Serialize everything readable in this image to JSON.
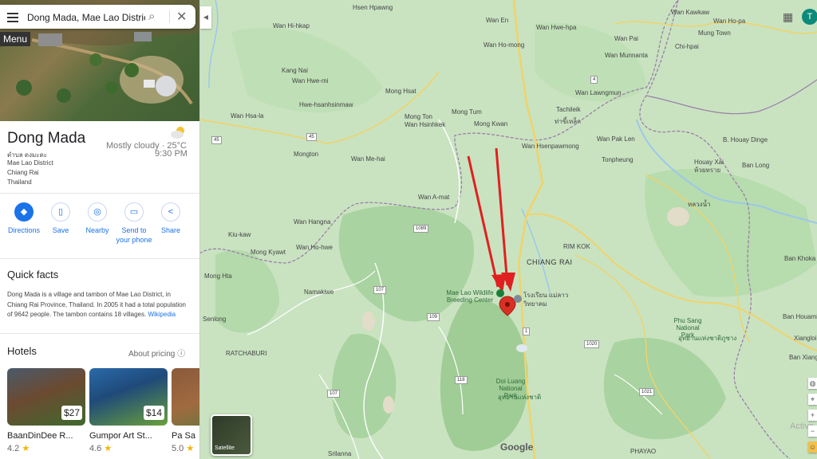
{
  "search": {
    "value": "Dong Mada, Mae Lao District, Chiang Rai",
    "menu_label": "Menu"
  },
  "place": {
    "name": "Dong Mada",
    "name_thai": "ตำบล ดงมะดะ",
    "address": [
      "Mae Lao District",
      "Chiang Rai",
      "Thailand"
    ],
    "weather": "Mostly cloudy · 25°C",
    "time": "9:30 PM"
  },
  "actions": [
    "Directions",
    "Save",
    "Nearby",
    "Send to your phone",
    "Share"
  ],
  "quick_facts": {
    "heading": "Quick facts",
    "text": "Dong Mada is a village and tambon of Mae Lao District, in Chiang Rai Province, Thailand. In 2005 it had a total population of 9642 people. The tambon contains 18 villages.",
    "link": "Wikipedia"
  },
  "hotels": {
    "heading": "Hotels",
    "about_pricing": "About pricing",
    "items": [
      {
        "name": "BaanDinDee R...",
        "rating": "4.2",
        "price": "$27"
      },
      {
        "name": "Gumpor Art St...",
        "rating": "4.6",
        "price": "$14"
      },
      {
        "name": "Pa Sa",
        "rating": "5.0",
        "price": ""
      }
    ]
  },
  "map": {
    "satellite_label": "Satellite",
    "attribution": "Google",
    "activate_text": "Activa",
    "avatar_letter": "T",
    "labels": [
      "Hsen Hpawng",
      "Wan Hi-hkap",
      "Wan En",
      "Wan Hsa",
      "Wan Kawkaw",
      "Wan Hwe-hpa",
      "Wan Ho-mong",
      "Wan Pai",
      "Wan Ho-pa",
      "Mung Town",
      "Chi-hpai",
      "Wan Munnanta",
      "Kang Nai",
      "Wan Hwe-mi",
      "Wan Lawngmun",
      "Mong Hsat",
      "Hwe-hsanhsinmaw",
      "Tachileik",
      "Wan Hsa-la",
      "Mong Ton",
      "Mong Tum",
      "Wan Hsinhkek",
      "Mong Kwan",
      "Wan Hsenpawmong",
      "Mongton",
      "Wan Pak Len",
      "Tonpheung",
      "B. Houay Dinge",
      "Houay Xai",
      "Wan Me-hai",
      "Ban Long",
      "Wan A-mat",
      "Wan Hangna",
      "Kiu-kaw",
      "Wan Ho-hwe",
      "Mong Kyawt",
      "Mong Hta",
      "Namakiwe",
      "RIM KOK",
      "CHIANG RAI",
      "Mae Lao Wildlife Breeding Center",
      "Ban Khoka",
      "Phu Sang National Park",
      "Ban Houamiang",
      "Xiangloi",
      "Ban Xiangh",
      "Doi Luang National Park",
      "RATCHABURI",
      "Srilanna",
      "PHAYAO",
      "Senlong"
    ],
    "thai_labels": [
      "เขตแฮนด์",
      "ท่าขี้เหล็ก",
      "ห้วยทราย",
      "หลวงน้ำ",
      "โรงเรียน แม่ลาว",
      "วิทยาคม",
      "อุทยานแห่งชาติ",
      "ดอยหลวง",
      "อุทยานแห่งชาติภูซาง"
    ],
    "route_shields": [
      "45",
      "45",
      "4",
      "1089",
      "107",
      "1098",
      "118",
      "1",
      "1020",
      "107",
      "1021",
      "118",
      "109"
    ]
  },
  "colors": {
    "accent": "#1a73e8",
    "arrow": "#e02020",
    "pin": "#d93025",
    "map_land": "#c9e3c1",
    "forest": "#a9d3a0",
    "border": "#9b7fa8",
    "road": "#f0d36a"
  }
}
